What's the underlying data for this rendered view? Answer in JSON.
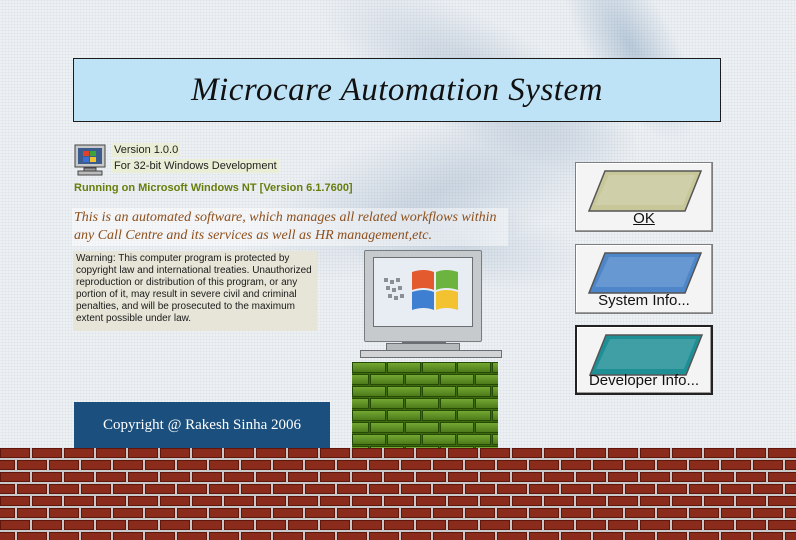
{
  "title": "Microcare Automation System",
  "version": "Version 1.0.0",
  "platform": "For 32-bit Windows Development",
  "running_on": "Running on Microsoft Windows NT [Version 6.1.7600]",
  "description": "This is an automated software, which manages all related workflows within any Call Centre and its services as well as HR management,etc.",
  "warning": "Warning: This computer program is protected by copyright law and international treaties. Unauthorized reproduction or distribution of this program, or any portion of it, may result in severe civil and criminal penalties, and will be prosecuted to the maximum extent possible under law.",
  "copyright": "Copyright @ Rakesh Sinha 2006",
  "buttons": {
    "ok": {
      "label": "OK",
      "color": "#c7c79a"
    },
    "system_info": {
      "label": "System Info...",
      "color": "#4d86c9"
    },
    "developer_info": {
      "label": "Developer Info...",
      "color": "#1f8f96"
    }
  },
  "icons": {
    "app_icon": "windows-computer-icon",
    "monitor": "windows-monitor-icon"
  },
  "colors": {
    "title_bg": "#bfe3f6",
    "copyright_bg": "#1b4f7e",
    "running_text": "#687d0c",
    "description_text": "#8d4f1b",
    "brick_red": "#8a2b1c",
    "brick_green": "#4d7b1a"
  }
}
